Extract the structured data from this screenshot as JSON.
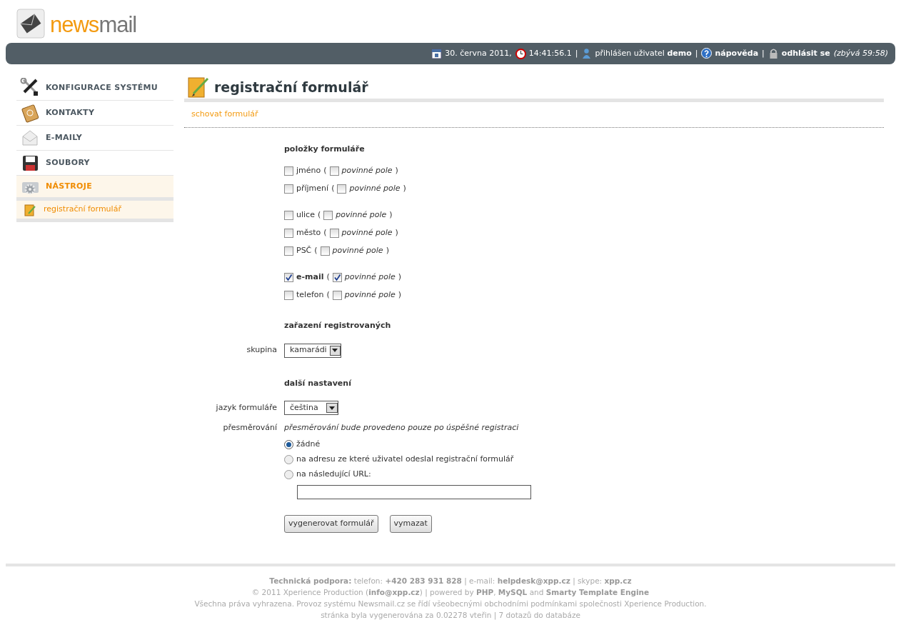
{
  "logo": {
    "accent": "news",
    "rest": "mail"
  },
  "header_bar": {
    "items": [
      {
        "kind": "date",
        "text": "30. června 2011,"
      },
      {
        "kind": "time",
        "text": "14:41:56.1"
      },
      {
        "kind": "separator",
        "text": "|"
      },
      {
        "kind": "user",
        "text": "přihlášen uživatel **demo**"
      },
      {
        "kind": "separator",
        "text": "|"
      },
      {
        "kind": "help",
        "text": "**nápověda**"
      },
      {
        "kind": "separator",
        "text": "|"
      },
      {
        "kind": "logout",
        "text": "**odhlásit se**"
      },
      {
        "kind": "note",
        "text": "(zbývá 59:58)"
      }
    ]
  },
  "sidebar": {
    "items": [
      {
        "kind": "tools",
        "label": "KONFIGURACE SYSTÉMU",
        "selected": false
      },
      {
        "kind": "contacts",
        "label": "KONTAKTY",
        "selected": false
      },
      {
        "kind": "mail",
        "label": "E-MAILY",
        "selected": false
      },
      {
        "kind": "files",
        "label": "SOUBORY",
        "selected": false
      },
      {
        "kind": "gear",
        "label": "NÁSTROJE",
        "selected": true,
        "children": [
          {
            "label": "registrační formulář",
            "selected": true
          }
        ]
      }
    ]
  },
  "page": {
    "title": "registrační formulář",
    "hide_link": "schovat formulář",
    "fields_heading": "položky formuláře",
    "field_groups": [
      {
        "fields": [
          {
            "label": "jméno",
            "open": "(",
            "checked": false,
            "required": false,
            "required_label": "povinné pole",
            "close": ")"
          },
          {
            "label": "příjmení",
            "open": "(",
            "checked": false,
            "required": false,
            "required_label": "povinné pole",
            "close": ")"
          }
        ]
      },
      {
        "fields": [
          {
            "label": "ulice",
            "open": "(",
            "checked": false,
            "required": false,
            "required_label": "povinné pole",
            "close": ")"
          },
          {
            "label": "město",
            "open": "(",
            "checked": false,
            "required": false,
            "required_label": "povinné pole",
            "close": ")"
          },
          {
            "label": "PSČ",
            "open": "(",
            "checked": false,
            "required": false,
            "required_label": "povinné pole",
            "close": ")"
          }
        ]
      },
      {
        "fields": [
          {
            "label": "e-mail",
            "open": "(",
            "checked": true,
            "required": true,
            "required_label": "povinné pole",
            "close": ")"
          },
          {
            "label": "telefon",
            "open": "(",
            "checked": false,
            "required": false,
            "required_label": "povinné pole",
            "close": ")"
          }
        ]
      }
    ],
    "assignment_heading": "zařazení registrovaných",
    "group_label": "skupina",
    "group_value": "kamarádi",
    "settings_heading": "další nastavení",
    "language_label": "jazyk formuláře",
    "language_value": "čeština",
    "redirect_label": "přesměrování",
    "redirect_note": "přesměrování bude provedeno pouze po úspěšné registraci",
    "redirect_options": [
      {
        "label": "žádné",
        "selected": true
      },
      {
        "label": "na adresu ze které uživatel odeslal registrační formulář",
        "selected": false
      },
      {
        "label": "na následující URL:",
        "selected": false
      }
    ],
    "buttons": [
      "vygenerovat formulář",
      "vymazat"
    ]
  },
  "footer": {
    "lines": [
      "**Technická podpora:** telefon: **+420 283 931 828** | e-mail: **helpdesk@xpp.cz** | skype: **xpp.cz**",
      "© 2011 Xperience Production (**info@xpp.cz**) | powered by **PHP**, **MySQL** and **Smarty Template Engine**",
      "Všechna práva vyhrazena. Provoz systému Newsmail.cz se řídí všeobecnými obchodními podmínkami společnosti Xperience Production.",
      "stránka byla vygenerována za 0.02278 vteřin | 7 dotazů do databáze"
    ]
  }
}
